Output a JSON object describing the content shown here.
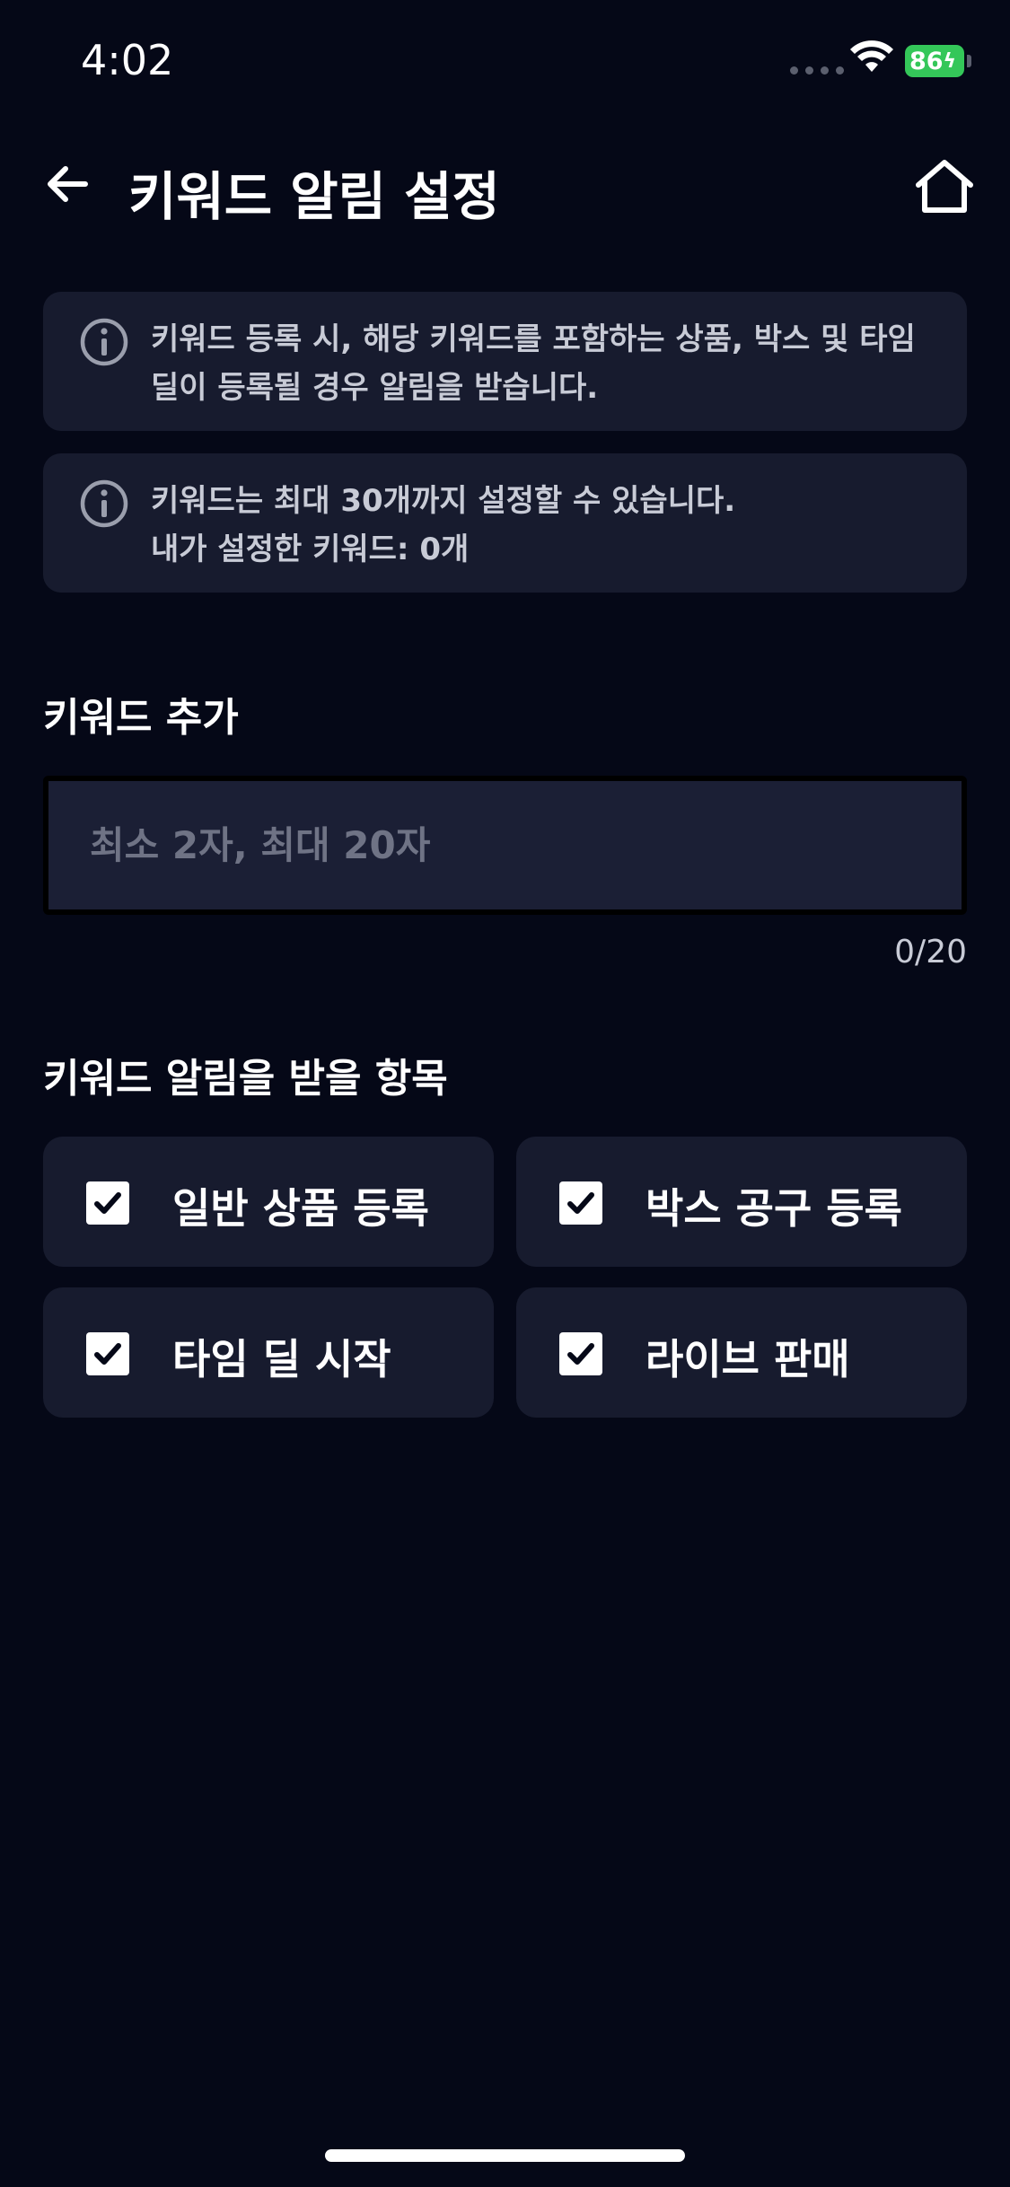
{
  "status_bar": {
    "time": "4:02",
    "battery": "86"
  },
  "header": {
    "title": "키워드 알림 설정",
    "back_icon": "arrow-left-icon",
    "home_icon": "home-icon"
  },
  "info": [
    {
      "icon": "info-icon",
      "text": "키워드 등록 시, 해당 키워드를 포함하는 상품, 박스 및 타임 딜이 등록될 경우 알림을 받습니다."
    },
    {
      "icon": "info-icon",
      "line1": "키워드는 최대 30개까지 설정할 수 있습니다.",
      "line2": "내가 설정한 키워드: 0개"
    }
  ],
  "add_section": {
    "label": "키워드 추가",
    "placeholder": "최소 2자, 최대 20자",
    "value": "",
    "counter": "0/20"
  },
  "items_section": {
    "label": "키워드 알림을 받을 항목",
    "options": [
      {
        "label": "일반 상품 등록",
        "checked": true
      },
      {
        "label": "박스 공구 등록",
        "checked": true
      },
      {
        "label": "타임 딜 시작",
        "checked": true
      },
      {
        "label": "라이브 판매",
        "checked": true
      }
    ]
  },
  "colors": {
    "background": "#050817",
    "card": "#171b2e",
    "input": "#1b1f35",
    "battery": "#34c759"
  }
}
